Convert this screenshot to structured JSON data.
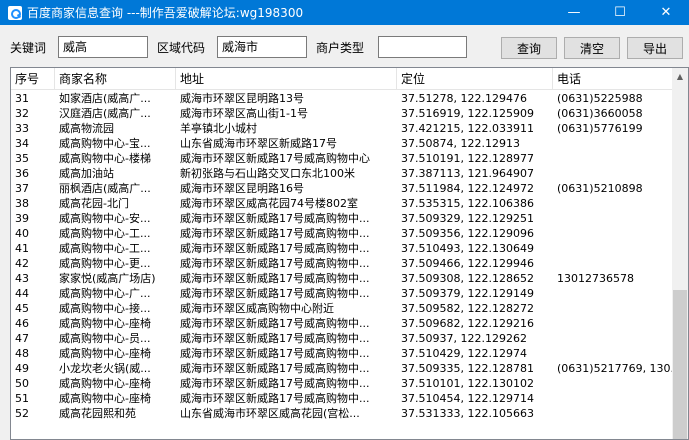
{
  "window": {
    "title": "百度商家信息查询 ---制作吾爱破解论坛:wg198300",
    "minimize": "—",
    "maximize": "☐",
    "close": "✕"
  },
  "toolbar": {
    "keyword_label": "关键词",
    "keyword_value": "威高",
    "area_code_label": "区域代码",
    "area_code_value": "威海市",
    "merchant_type_label": "商户类型",
    "merchant_type_value": "",
    "query_button": "查询",
    "clear_button": "清空",
    "export_button": "导出"
  },
  "table": {
    "headers": [
      "序号",
      "商家名称",
      "地址",
      "定位",
      "电话"
    ],
    "rows": [
      [
        "31",
        "如家酒店(威高广...",
        "威海市环翠区昆明路13号",
        "37.51278, 122.129476",
        "(0631)5225988"
      ],
      [
        "32",
        "汉庭酒店(威高广...",
        "威海市环翠区高山街1-1号",
        "37.516919, 122.125909",
        "(0631)3660058"
      ],
      [
        "33",
        "威高物流园",
        "羊亭镇北小城村",
        "37.421215, 122.033911",
        "(0631)5776199"
      ],
      [
        "34",
        "威高购物中心-宝...",
        "山东省威海市环翠区新威路17号",
        "37.50874, 122.12913",
        ""
      ],
      [
        "35",
        "威高购物中心-楼梯",
        "威海市环翠区新威路17号威高购物中心",
        "37.510191, 122.128977",
        ""
      ],
      [
        "36",
        "威高加油站",
        "新初张路与石山路交叉口东北100米",
        "37.387113, 121.964907",
        ""
      ],
      [
        "37",
        "丽枫酒店(威高广...",
        "威海市环翠区昆明路16号",
        "37.511984, 122.124972",
        "(0631)5210898"
      ],
      [
        "38",
        "威高花园-北门",
        "威海市环翠区威高花园74号楼802室",
        "37.535315, 122.106386",
        ""
      ],
      [
        "39",
        "威高购物中心-安...",
        "威海市环翠区新威路17号威高购物中...",
        "37.509329, 122.129251",
        ""
      ],
      [
        "40",
        "威高购物中心-工...",
        "威海市环翠区新威路17号威高购物中...",
        "37.509356, 122.129096",
        ""
      ],
      [
        "41",
        "威高购物中心-工...",
        "威海市环翠区新威路17号威高购物中...",
        "37.510493, 122.130649",
        ""
      ],
      [
        "42",
        "威高购物中心-更...",
        "威海市环翠区新威路17号威高购物中...",
        "37.509466, 122.129946",
        ""
      ],
      [
        "43",
        "家家悦(威高广场店)",
        "威海市环翠区新威路17号威高购物中...",
        "37.509308, 122.128652",
        "13012736578"
      ],
      [
        "44",
        "威高购物中心-广...",
        "威海市环翠区新威路17号威高购物中...",
        "37.509379, 122.129149",
        ""
      ],
      [
        "45",
        "威高购物中心-接...",
        "威海市环翠区威高购物中心附近",
        "37.509582, 122.128272",
        ""
      ],
      [
        "46",
        "威高购物中心-座椅",
        "威海市环翠区新威路17号威高购物中...",
        "37.509682, 122.129216",
        ""
      ],
      [
        "47",
        "威高购物中心-员...",
        "威海市环翠区新威路17号威高购物中...",
        "37.50937, 122.129262",
        ""
      ],
      [
        "48",
        "威高购物中心-座椅",
        "威海市环翠区新威路17号威高购物中...",
        "37.510429, 122.12974",
        ""
      ],
      [
        "49",
        "小龙坎老火锅(威...",
        "威海市环翠区新威路17号威高购物中...",
        "37.509335, 122.128781",
        "(0631)5217769, 130..."
      ],
      [
        "50",
        "威高购物中心-座椅",
        "威海市环翠区新威路17号威高购物中...",
        "37.510101, 122.130102",
        ""
      ],
      [
        "51",
        "威高购物中心-座椅",
        "威海市环翠区新威路17号威高购物中...",
        "37.510454, 122.129714",
        ""
      ],
      [
        "52",
        "威高花园熙和苑",
        "山东省威海市环翠区威高花园(宫松...",
        "37.531333, 122.105663",
        ""
      ]
    ]
  },
  "scrollbar": {
    "up_arrow": "▲"
  }
}
